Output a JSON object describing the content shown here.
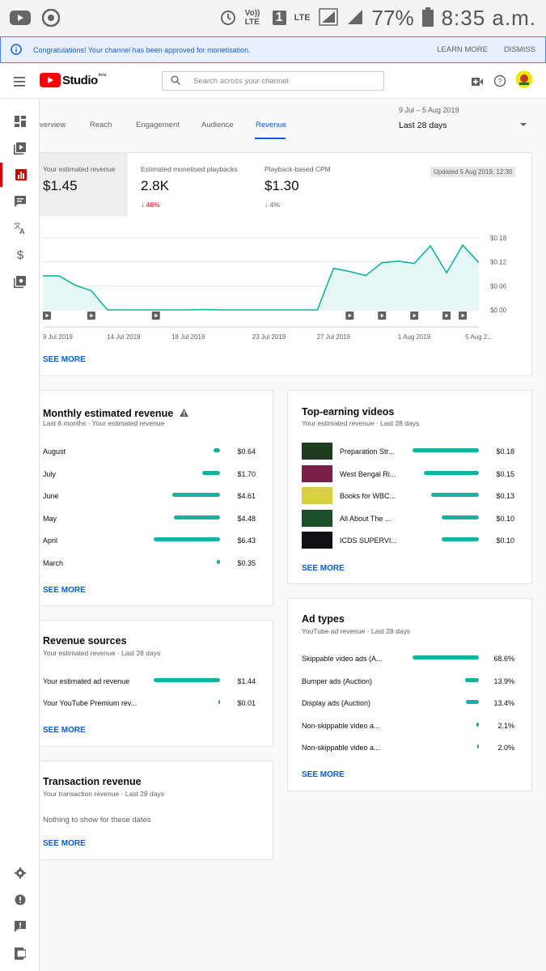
{
  "statusbar": {
    "battery_pct": "77%",
    "time": "8:35 a.m.",
    "network": "LTE",
    "volte": "Vo)) LTE",
    "sim": "1"
  },
  "banner": {
    "message": "Congratulations! Your channel has been approved for monetisation.",
    "learn_more": "LEARN MORE",
    "dismiss": "DISMISS"
  },
  "appbar": {
    "logo_text": "Studio",
    "beta": "beta",
    "search_placeholder": "Search across your channel"
  },
  "tabs": [
    "verview",
    "Reach",
    "Engagement",
    "Audience",
    "Revenue"
  ],
  "active_tab": "Revenue",
  "date": {
    "range": "9 Jul – 5 Aug 2019",
    "label": "Last 28 days"
  },
  "metrics": [
    {
      "label": "Your estimated revenue",
      "value": "$1.45",
      "change": ""
    },
    {
      "label": "Estimated monetised playbacks",
      "value": "2.8K",
      "change": "↓ 46%"
    },
    {
      "label": "Playback-based CPM",
      "value": "$1.30",
      "change": "↓ 4%"
    }
  ],
  "updated": "Updated 5 Aug 2019, 12:30",
  "chart_data": {
    "type": "area",
    "x": [
      "9 Jul 2019",
      "10 Jul",
      "11 Jul",
      "12 Jul",
      "13 Jul",
      "14 Jul",
      "15 Jul",
      "16 Jul",
      "17 Jul",
      "18 Jul",
      "19 Jul",
      "20 Jul",
      "21 Jul",
      "22 Jul",
      "23 Jul",
      "24 Jul",
      "25 Jul",
      "26 Jul",
      "27 Jul",
      "28 Jul",
      "29 Jul",
      "30 Jul",
      "31 Jul",
      "1 Aug",
      "2 Aug",
      "3 Aug",
      "4 Aug",
      "5 Aug"
    ],
    "values": [
      0.085,
      0.085,
      0.062,
      0.048,
      0.0,
      0.0,
      0.0,
      0.0,
      0.0,
      0.0,
      0.001,
      0.0,
      0.0,
      0.0,
      0.0,
      0.0,
      0.0,
      0.0,
      0.104,
      0.096,
      0.086,
      0.118,
      0.122,
      0.116,
      0.16,
      0.093,
      0.162,
      0.118
    ],
    "xticks": [
      "9 Jul 2019",
      "14 Jul 2019",
      "18 Jul 2019",
      "23 Jul 2019",
      "27 Jul 2019",
      "1 Aug 2019",
      "5 Aug 2..."
    ],
    "yticks": [
      "$0.18",
      "$0.12",
      "$0.06",
      "$0.00"
    ],
    "ylim": [
      0,
      0.18
    ],
    "color": "#12b4a0"
  },
  "see_more": "SEE MORE",
  "monthly": {
    "title": "Monthly estimated revenue",
    "subtitle": "Last 6 months · Your estimated revenue",
    "rows": [
      {
        "label": "August",
        "value": "$0.64",
        "amount": 0.64
      },
      {
        "label": "July",
        "value": "$1.70",
        "amount": 1.7
      },
      {
        "label": "June",
        "value": "$4.61",
        "amount": 4.61
      },
      {
        "label": "May",
        "value": "$4.48",
        "amount": 4.48
      },
      {
        "label": "April",
        "value": "$6.43",
        "amount": 6.43
      },
      {
        "label": "March",
        "value": "$0.35",
        "amount": 0.35
      }
    ]
  },
  "top_videos": {
    "title": "Top-earning videos",
    "subtitle": "Your estimated revenue · Last 28 days",
    "rows": [
      {
        "label": "Preparation Str...",
        "value": "$0.18",
        "amount": 0.18
      },
      {
        "label": "West Bengal Ri...",
        "value": "$0.15",
        "amount": 0.15
      },
      {
        "label": "Books for WBC...",
        "value": "$0.13",
        "amount": 0.13
      },
      {
        "label": "All About The ...",
        "value": "$0.10",
        "amount": 0.1
      },
      {
        "label": "ICDS SUPERVI...",
        "value": "$0.10",
        "amount": 0.1
      }
    ]
  },
  "sources": {
    "title": "Revenue sources",
    "subtitle": "Your estimated revenue · Last 28 days",
    "rows": [
      {
        "label": "Your estimated ad revenue",
        "value": "$1.44",
        "amount": 1.44
      },
      {
        "label": "Your YouTube Premium rev...",
        "value": "$0.01",
        "amount": 0.01
      }
    ]
  },
  "transactions": {
    "title": "Transaction revenue",
    "subtitle": "Your transaction revenue · Last 28 days",
    "empty": "Nothing to show for these dates"
  },
  "ad_types": {
    "title": "Ad types",
    "subtitle": "YouTube ad revenue · Last 28 days",
    "rows": [
      {
        "label": "Skippable video ads (A...",
        "value": "68.6%",
        "amount": 68.6
      },
      {
        "label": "Bumper ads (Auction)",
        "value": "13.9%",
        "amount": 13.9
      },
      {
        "label": "Display ads (Auction)",
        "value": "13.4%",
        "amount": 13.4
      },
      {
        "label": "Non-skippable video a...",
        "value": "2.1%",
        "amount": 2.1
      },
      {
        "label": "Non-skippable video a...",
        "value": "2.0%",
        "amount": 2.0
      }
    ]
  }
}
